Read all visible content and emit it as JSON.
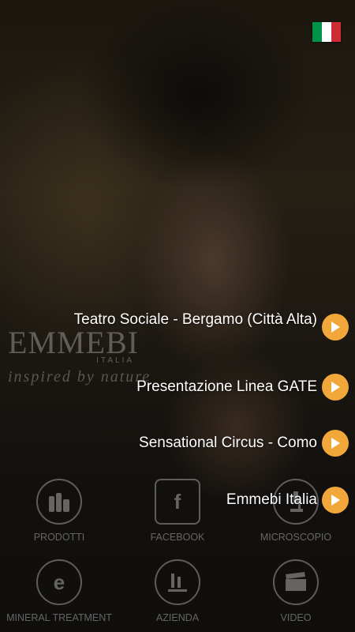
{
  "language_flag": {
    "colors": [
      "#009246",
      "#ffffff",
      "#ce2b37"
    ],
    "icon": "italy-flag-icon"
  },
  "logo": {
    "name": "EMMEBI",
    "sub": "ITALIA",
    "tagline": "inspired by nature"
  },
  "grid": [
    {
      "label": "PRODOTTI",
      "icon": "products-icon"
    },
    {
      "label": "FACEBOOK",
      "icon": "facebook-icon"
    },
    {
      "label": "MICROSCOPIO",
      "icon": "microscope-icon"
    },
    {
      "label": "MINERAL TREATMENT",
      "icon": "mineral-treatment-icon"
    },
    {
      "label": "AZIENDA",
      "icon": "company-icon"
    },
    {
      "label": "VIDEO",
      "icon": "video-clapper-icon"
    }
  ],
  "videos": [
    {
      "title": "Teatro Sociale - Bergamo (Città Alta)"
    },
    {
      "title": "Presentazione Linea GATE"
    },
    {
      "title": "Sensational Circus - Como"
    },
    {
      "title": "Emmebi Italia"
    }
  ],
  "accent_color": "#f1a73a"
}
